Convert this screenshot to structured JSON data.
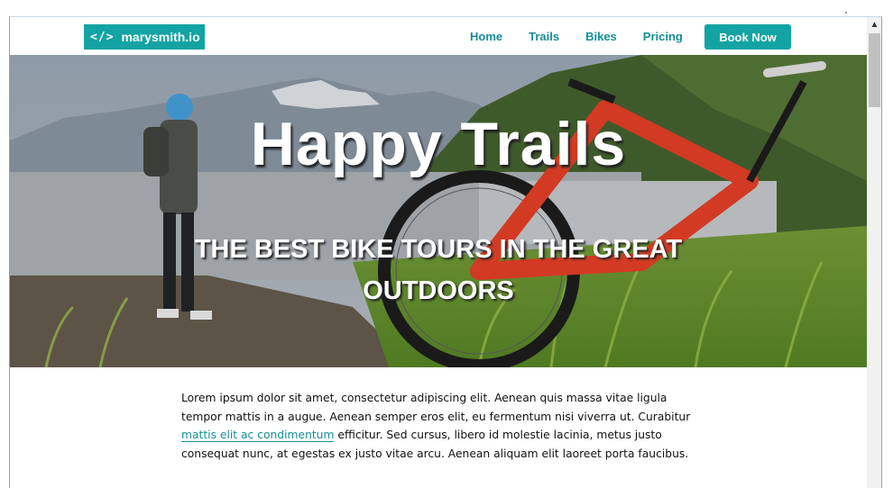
{
  "brand": {
    "icon": "code-brackets-icon",
    "code_glyph": "</>",
    "name": "marysmith.io",
    "color": "#13a3a3"
  },
  "nav": {
    "links": [
      {
        "label": "Home"
      },
      {
        "label": "Trails"
      },
      {
        "label": "Bikes"
      },
      {
        "label": "Pricing"
      }
    ],
    "cta": "Book Now"
  },
  "hero": {
    "title": "Happy Trails",
    "subtitle": "THE BEST BIKE TOURS IN THE GREAT OUTDOORS"
  },
  "content": {
    "paragraph_before_link": "Lorem ipsum dolor sit amet, consectetur adipiscing elit. Aenean quis massa vitae ligula tempor mattis in a augue. Aenean semper eros elit, eu fermentum nisi viverra ut. Curabitur ",
    "link_text": "mattis elit ac condimentum",
    "paragraph_after_link": " efficitur. Sed cursus, libero id molestie lacinia, metus justo consequat nunc, at egestas ex justo vitae arcu. Aenean aliquam elit laoreet porta faucibus."
  },
  "colors": {
    "accent": "#13a3a3",
    "link": "#148f97"
  }
}
